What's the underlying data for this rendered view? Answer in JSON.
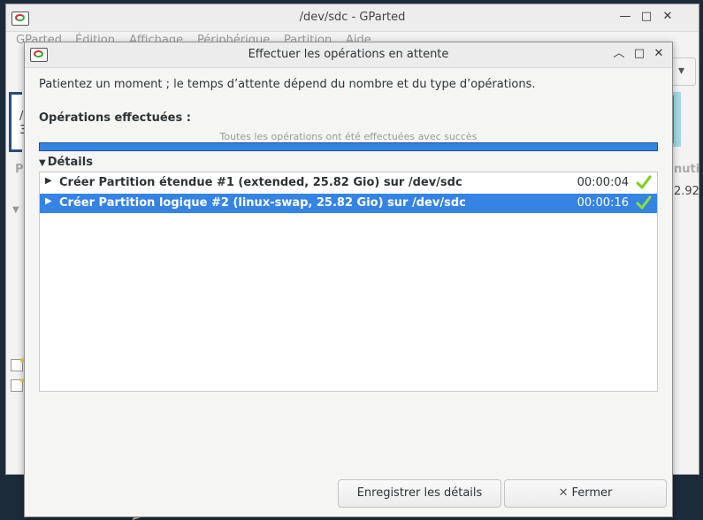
{
  "main_window": {
    "title": "/dev/sdc - GParted",
    "menu": [
      "GParted",
      "Édition",
      "Affichage",
      "Périphérique",
      "Partition",
      "Aide"
    ],
    "side_values": [
      "/",
      "3"
    ],
    "size_value": "2.92",
    "column_header_partial": "nuti"
  },
  "dialog": {
    "title": "Effectuer les opérations en attente",
    "message": "Patientez un moment ; le temps d’attente dépend du nombre et du type d’opérations.",
    "operations_label": "Opérations effectuées :",
    "progress_text": "Toutes les opérations ont été effectuées avec succès",
    "progress_fraction": 1.0,
    "details_label": "Détails",
    "operations": [
      {
        "label": "Créer Partition étendue #1 (extended, 25.82 Gio) sur /dev/sdc",
        "time": "00:00:04",
        "status_icon": "check-icon",
        "selected": false
      },
      {
        "label": "Créer Partition logique #2 (linux-swap, 25.82 Gio) sur /dev/sdc",
        "time": "00:00:16",
        "status_icon": "check-icon",
        "selected": true
      }
    ],
    "buttons": {
      "save_details": "Enregistrer les détails",
      "close": "Fermer"
    }
  },
  "colors": {
    "accent": "#3584e4",
    "success": "#73d216"
  }
}
